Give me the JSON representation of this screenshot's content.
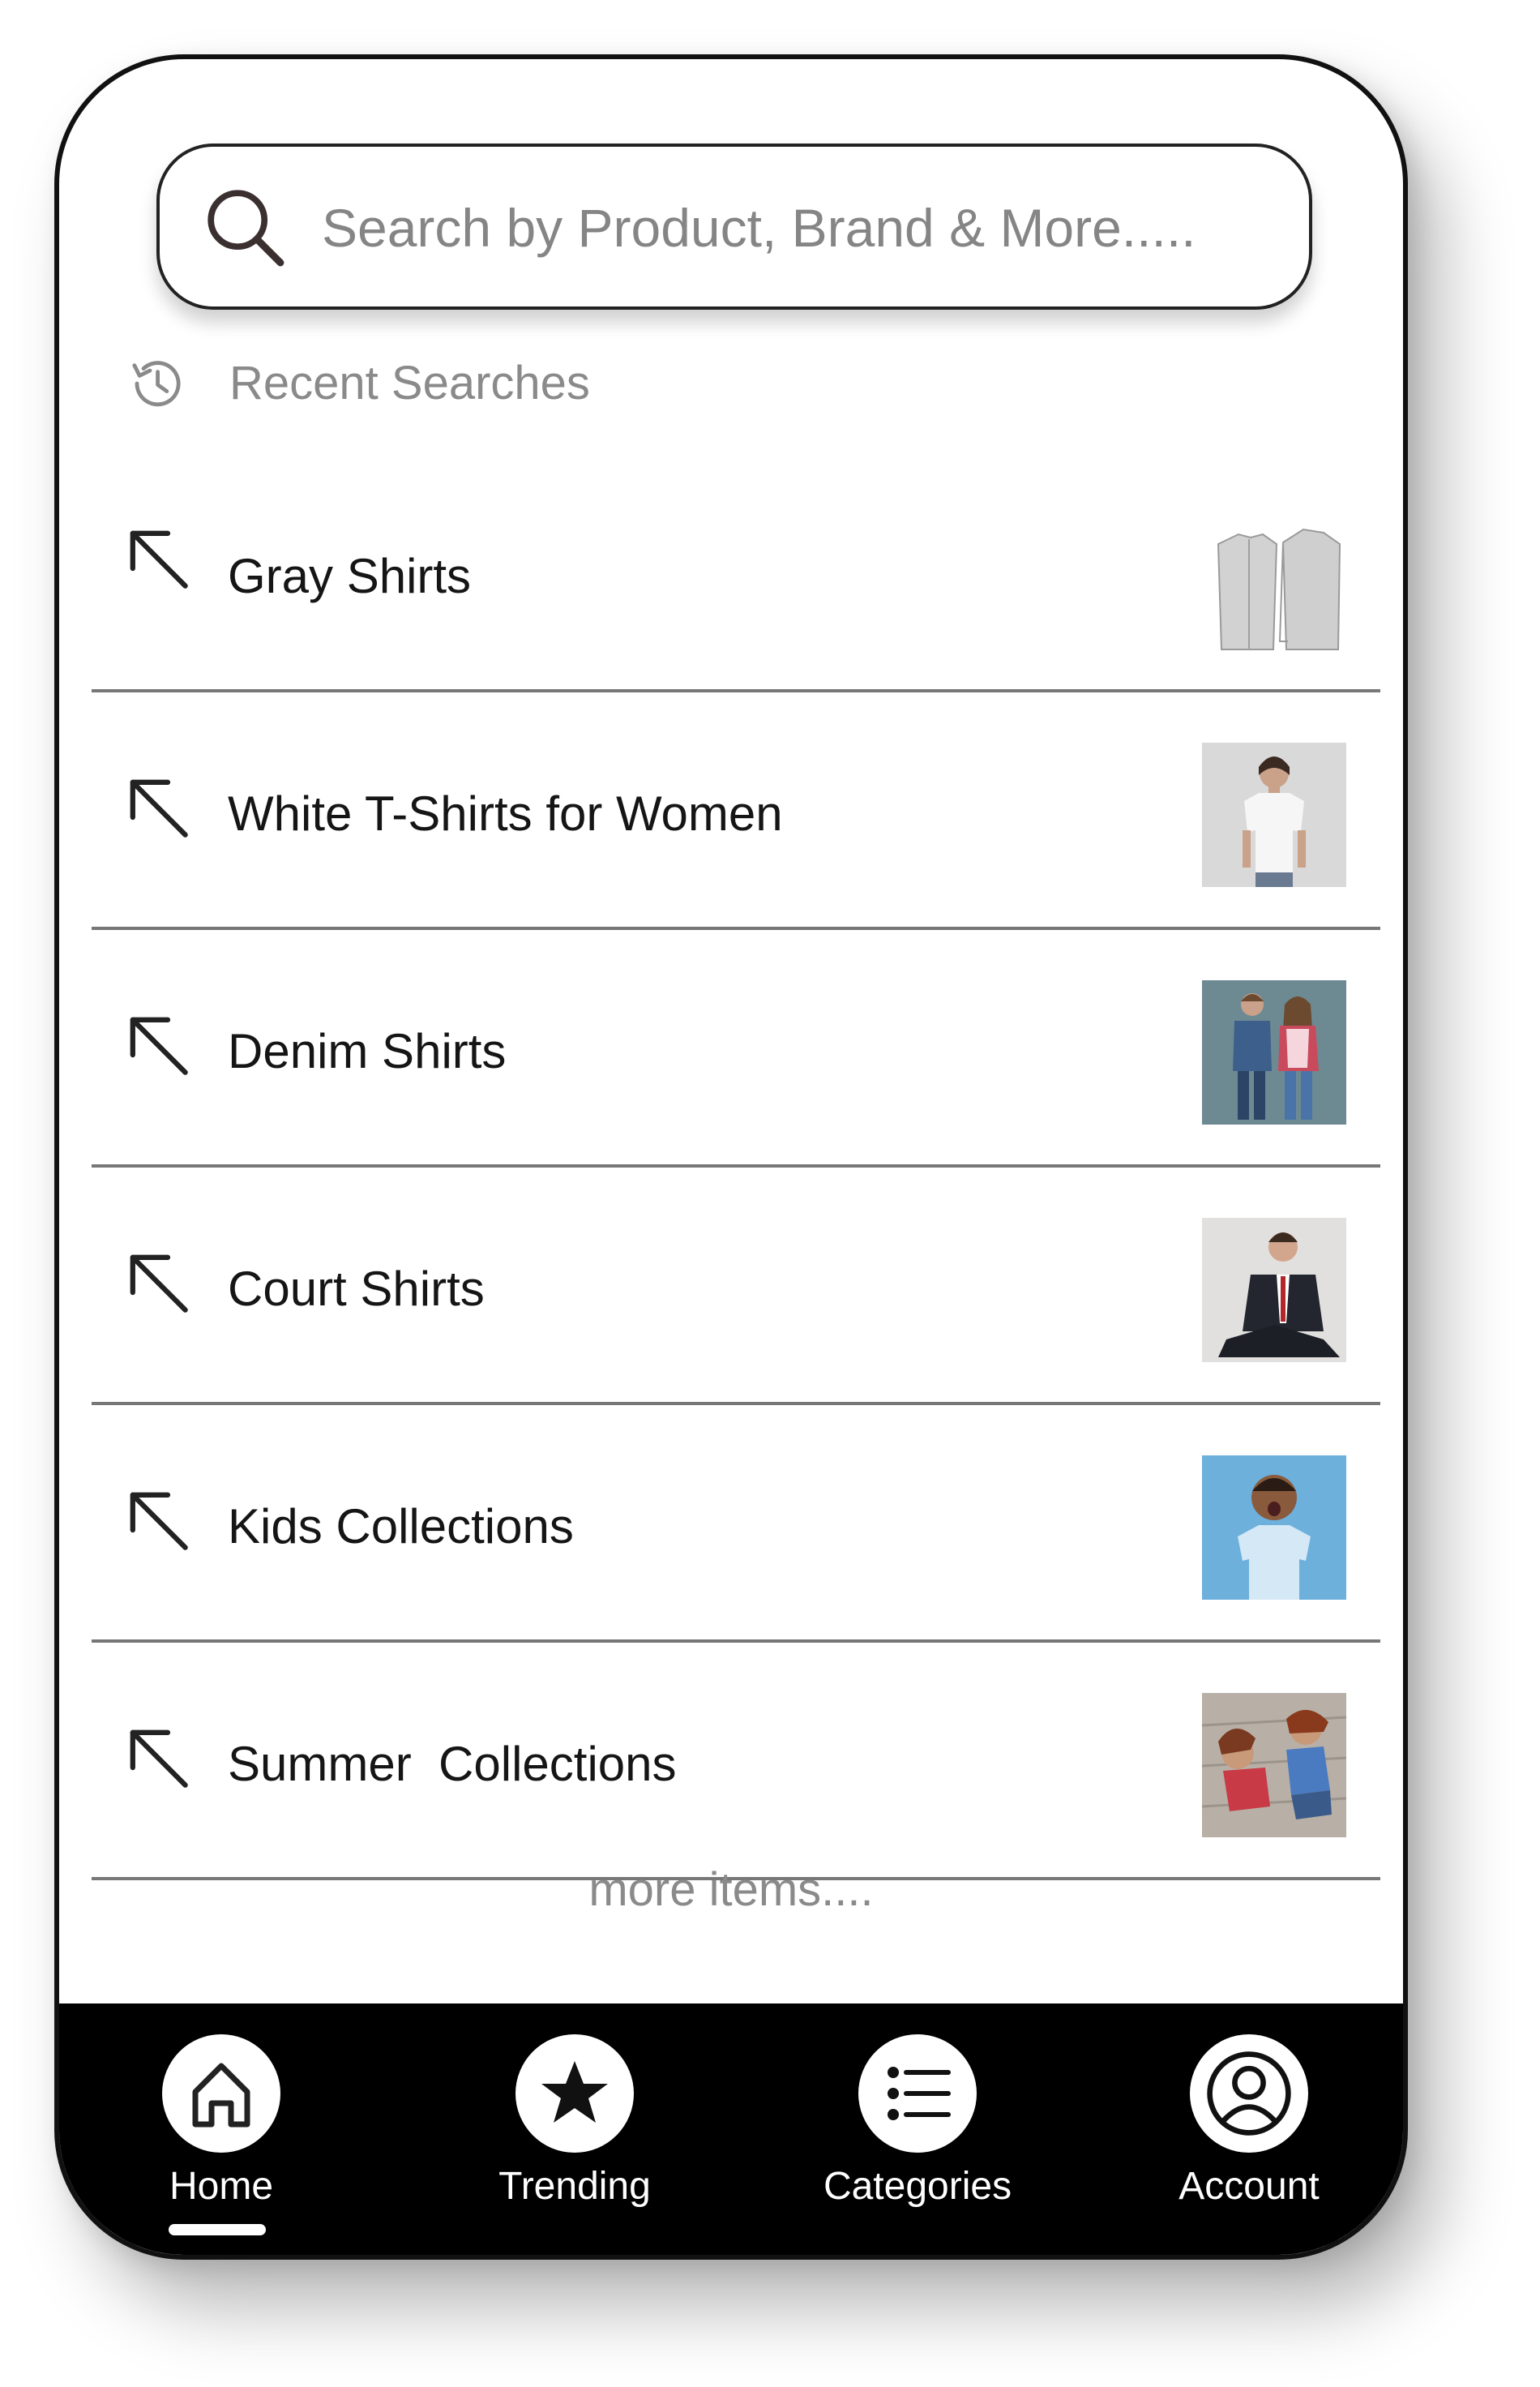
{
  "search": {
    "placeholder": "Search by Product, Brand & More....."
  },
  "recent": {
    "title": "Recent Searches",
    "items": [
      {
        "label": "Gray Shirts",
        "thumb": "gray-shirts"
      },
      {
        "label": "White T-Shirts for Women",
        "thumb": "white-tshirt-woman"
      },
      {
        "label": "Denim Shirts",
        "thumb": "denim-kids"
      },
      {
        "label": "Court Shirts",
        "thumb": "man-in-suit"
      },
      {
        "label": "Kids Collections",
        "thumb": "kid-laughing"
      },
      {
        "label": "Summer  Collections",
        "thumb": "summer-kids"
      }
    ]
  },
  "more_label": "more items....",
  "nav": {
    "active": "Home",
    "items": [
      {
        "label": "Home",
        "icon": "home-icon"
      },
      {
        "label": "Trending",
        "icon": "star-icon"
      },
      {
        "label": "Categories",
        "icon": "list-icon"
      },
      {
        "label": "Account",
        "icon": "user-icon"
      }
    ]
  },
  "colors": {
    "background": "#ffffff",
    "nav_bg": "#000000",
    "muted_text": "#858585",
    "text": "#151515"
  }
}
